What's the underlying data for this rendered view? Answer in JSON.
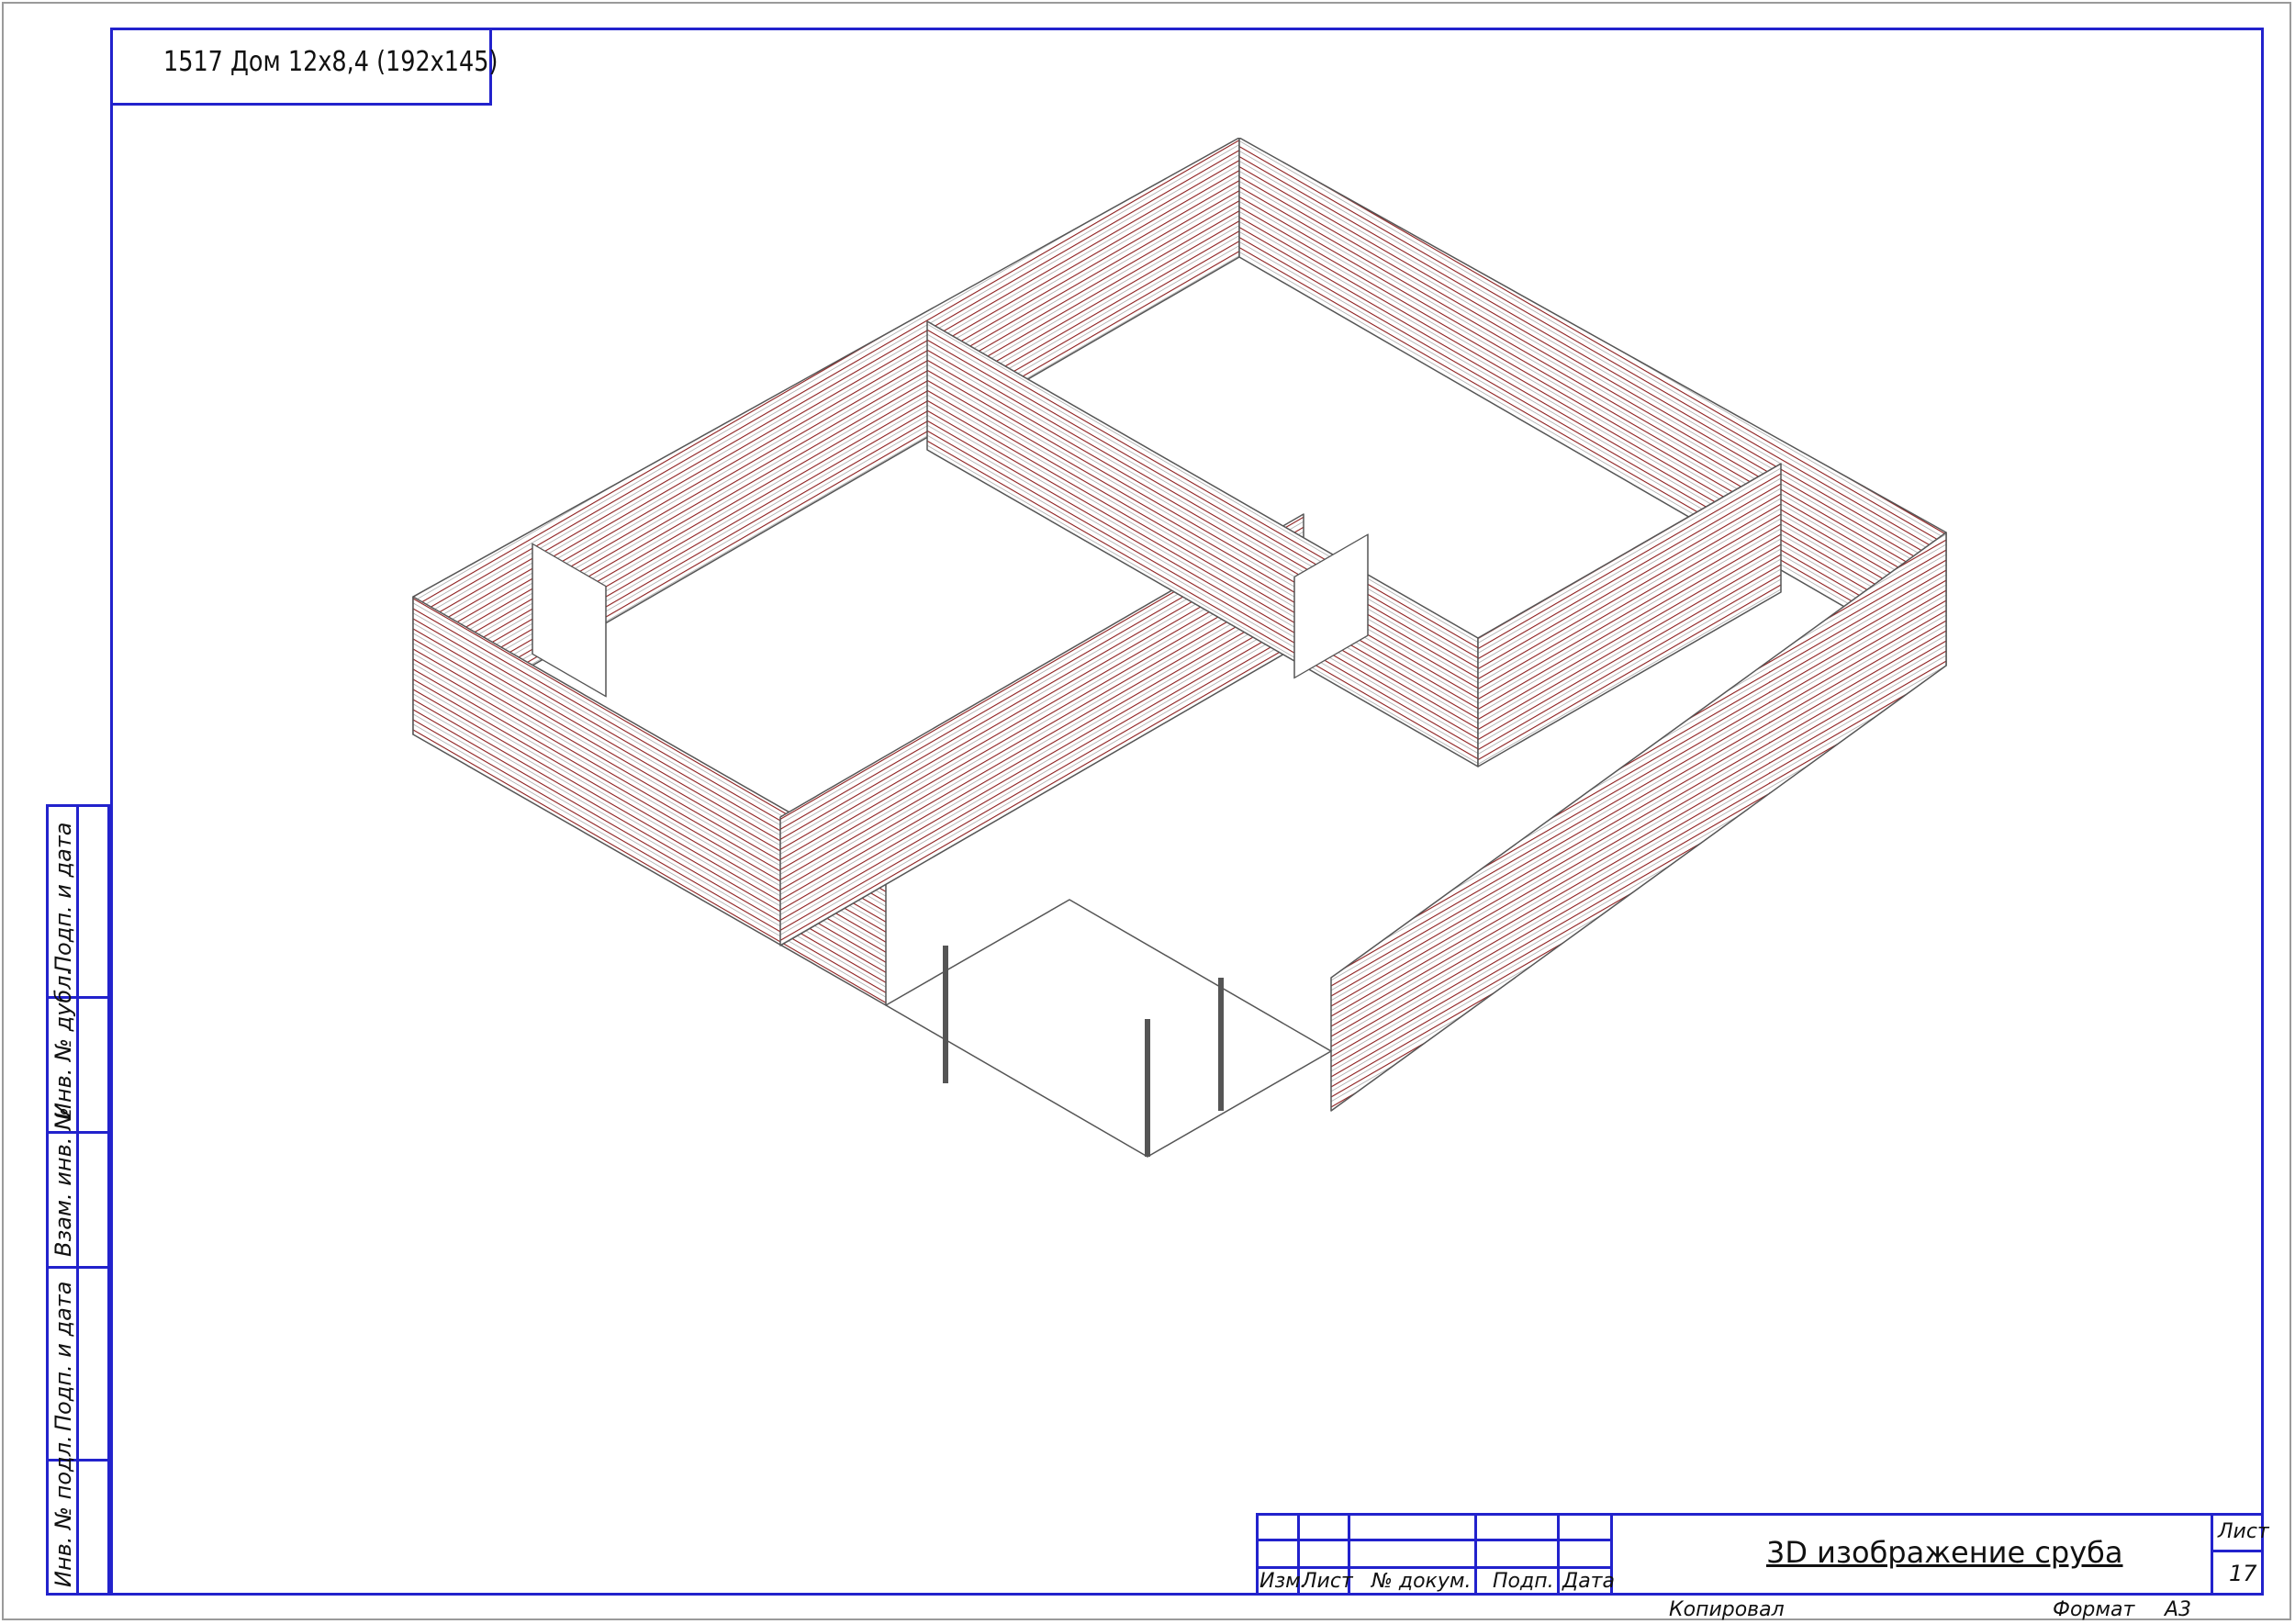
{
  "title": "1517 Дом 12х8,4 (192х145)",
  "side_stamp": [
    "Подп. и дата",
    "Инв. № дубл.",
    "Взам. инв. №",
    "Подп. и дата",
    "Инв. № подл."
  ],
  "stamp": {
    "columns": [
      "Изм.",
      "Лист",
      "№ докум.",
      "Подп.",
      "Дата"
    ],
    "sheet_title": "3D изображение сруба",
    "sheet_label": "Лист",
    "sheet_number": "17",
    "copied_label": "Копировал",
    "format_label": "Формат",
    "format_value": "А3"
  },
  "colors": {
    "frame": "#2222cc",
    "outline": "#555555",
    "log_line": "#8b1a1a",
    "background": "#ffffff"
  }
}
